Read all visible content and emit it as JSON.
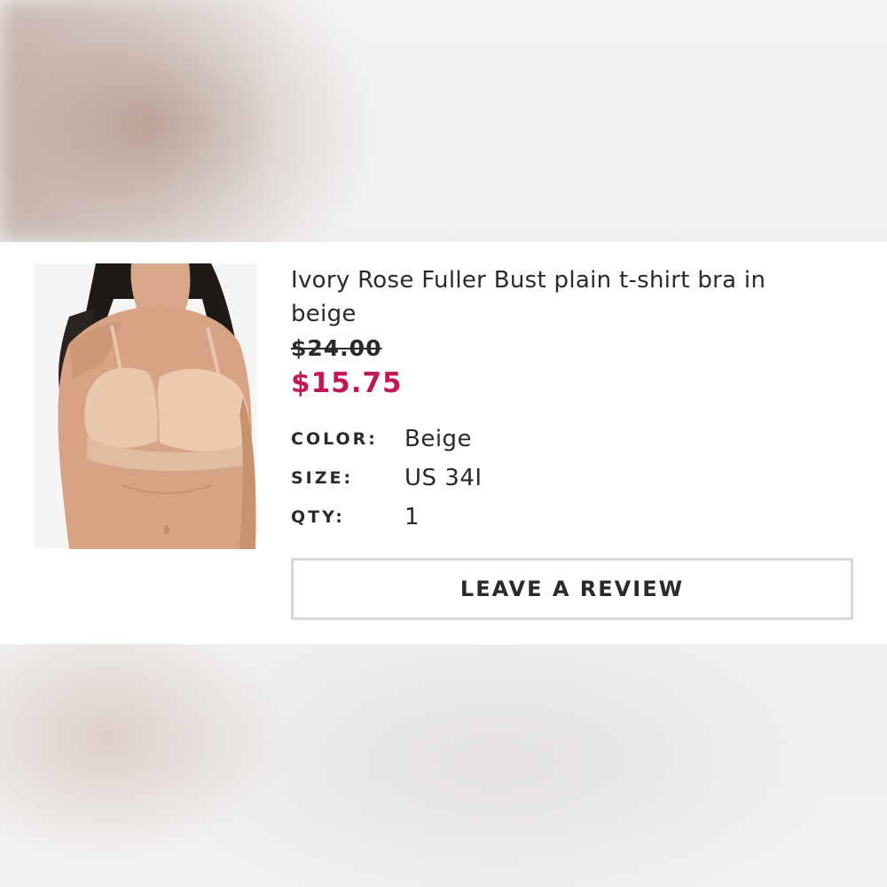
{
  "product": {
    "title": "Ivory Rose Fuller Bust plain t-shirt bra in beige",
    "original_price": "$24.00",
    "sale_price": "$15.75",
    "image_icon": "product-photo"
  },
  "attributes": [
    {
      "label": "COLOR:",
      "value": "Beige"
    },
    {
      "label": "SIZE:",
      "value": "US 34I"
    },
    {
      "label": "QTY:",
      "value": "1"
    }
  ],
  "actions": {
    "review_label": "LEAVE A REVIEW"
  },
  "colors": {
    "sale_price": "#c2174f",
    "text": "#2a2a2a",
    "button_border": "#d8d8d8"
  }
}
